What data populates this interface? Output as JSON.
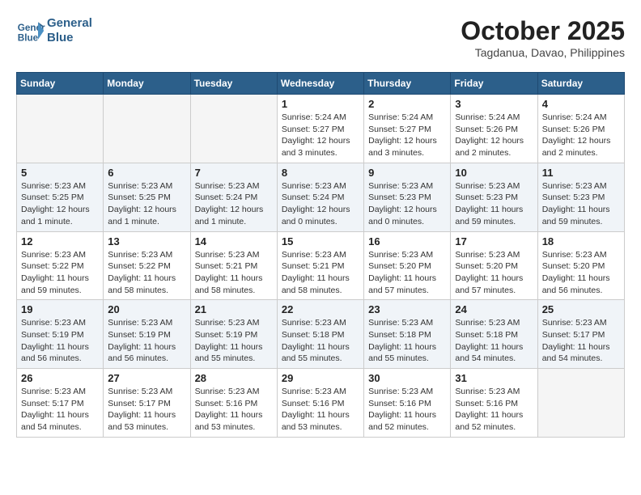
{
  "header": {
    "logo_line1": "General",
    "logo_line2": "Blue",
    "month": "October 2025",
    "location": "Tagdanua, Davao, Philippines"
  },
  "weekdays": [
    "Sunday",
    "Monday",
    "Tuesday",
    "Wednesday",
    "Thursday",
    "Friday",
    "Saturday"
  ],
  "weeks": [
    [
      {
        "day": "",
        "info": ""
      },
      {
        "day": "",
        "info": ""
      },
      {
        "day": "",
        "info": ""
      },
      {
        "day": "1",
        "info": "Sunrise: 5:24 AM\nSunset: 5:27 PM\nDaylight: 12 hours and 3 minutes."
      },
      {
        "day": "2",
        "info": "Sunrise: 5:24 AM\nSunset: 5:27 PM\nDaylight: 12 hours and 3 minutes."
      },
      {
        "day": "3",
        "info": "Sunrise: 5:24 AM\nSunset: 5:26 PM\nDaylight: 12 hours and 2 minutes."
      },
      {
        "day": "4",
        "info": "Sunrise: 5:24 AM\nSunset: 5:26 PM\nDaylight: 12 hours and 2 minutes."
      }
    ],
    [
      {
        "day": "5",
        "info": "Sunrise: 5:23 AM\nSunset: 5:25 PM\nDaylight: 12 hours and 1 minute."
      },
      {
        "day": "6",
        "info": "Sunrise: 5:23 AM\nSunset: 5:25 PM\nDaylight: 12 hours and 1 minute."
      },
      {
        "day": "7",
        "info": "Sunrise: 5:23 AM\nSunset: 5:24 PM\nDaylight: 12 hours and 1 minute."
      },
      {
        "day": "8",
        "info": "Sunrise: 5:23 AM\nSunset: 5:24 PM\nDaylight: 12 hours and 0 minutes."
      },
      {
        "day": "9",
        "info": "Sunrise: 5:23 AM\nSunset: 5:23 PM\nDaylight: 12 hours and 0 minutes."
      },
      {
        "day": "10",
        "info": "Sunrise: 5:23 AM\nSunset: 5:23 PM\nDaylight: 11 hours and 59 minutes."
      },
      {
        "day": "11",
        "info": "Sunrise: 5:23 AM\nSunset: 5:23 PM\nDaylight: 11 hours and 59 minutes."
      }
    ],
    [
      {
        "day": "12",
        "info": "Sunrise: 5:23 AM\nSunset: 5:22 PM\nDaylight: 11 hours and 59 minutes."
      },
      {
        "day": "13",
        "info": "Sunrise: 5:23 AM\nSunset: 5:22 PM\nDaylight: 11 hours and 58 minutes."
      },
      {
        "day": "14",
        "info": "Sunrise: 5:23 AM\nSunset: 5:21 PM\nDaylight: 11 hours and 58 minutes."
      },
      {
        "day": "15",
        "info": "Sunrise: 5:23 AM\nSunset: 5:21 PM\nDaylight: 11 hours and 58 minutes."
      },
      {
        "day": "16",
        "info": "Sunrise: 5:23 AM\nSunset: 5:20 PM\nDaylight: 11 hours and 57 minutes."
      },
      {
        "day": "17",
        "info": "Sunrise: 5:23 AM\nSunset: 5:20 PM\nDaylight: 11 hours and 57 minutes."
      },
      {
        "day": "18",
        "info": "Sunrise: 5:23 AM\nSunset: 5:20 PM\nDaylight: 11 hours and 56 minutes."
      }
    ],
    [
      {
        "day": "19",
        "info": "Sunrise: 5:23 AM\nSunset: 5:19 PM\nDaylight: 11 hours and 56 minutes."
      },
      {
        "day": "20",
        "info": "Sunrise: 5:23 AM\nSunset: 5:19 PM\nDaylight: 11 hours and 56 minutes."
      },
      {
        "day": "21",
        "info": "Sunrise: 5:23 AM\nSunset: 5:19 PM\nDaylight: 11 hours and 55 minutes."
      },
      {
        "day": "22",
        "info": "Sunrise: 5:23 AM\nSunset: 5:18 PM\nDaylight: 11 hours and 55 minutes."
      },
      {
        "day": "23",
        "info": "Sunrise: 5:23 AM\nSunset: 5:18 PM\nDaylight: 11 hours and 55 minutes."
      },
      {
        "day": "24",
        "info": "Sunrise: 5:23 AM\nSunset: 5:18 PM\nDaylight: 11 hours and 54 minutes."
      },
      {
        "day": "25",
        "info": "Sunrise: 5:23 AM\nSunset: 5:17 PM\nDaylight: 11 hours and 54 minutes."
      }
    ],
    [
      {
        "day": "26",
        "info": "Sunrise: 5:23 AM\nSunset: 5:17 PM\nDaylight: 11 hours and 54 minutes."
      },
      {
        "day": "27",
        "info": "Sunrise: 5:23 AM\nSunset: 5:17 PM\nDaylight: 11 hours and 53 minutes."
      },
      {
        "day": "28",
        "info": "Sunrise: 5:23 AM\nSunset: 5:16 PM\nDaylight: 11 hours and 53 minutes."
      },
      {
        "day": "29",
        "info": "Sunrise: 5:23 AM\nSunset: 5:16 PM\nDaylight: 11 hours and 53 minutes."
      },
      {
        "day": "30",
        "info": "Sunrise: 5:23 AM\nSunset: 5:16 PM\nDaylight: 11 hours and 52 minutes."
      },
      {
        "day": "31",
        "info": "Sunrise: 5:23 AM\nSunset: 5:16 PM\nDaylight: 11 hours and 52 minutes."
      },
      {
        "day": "",
        "info": ""
      }
    ]
  ]
}
